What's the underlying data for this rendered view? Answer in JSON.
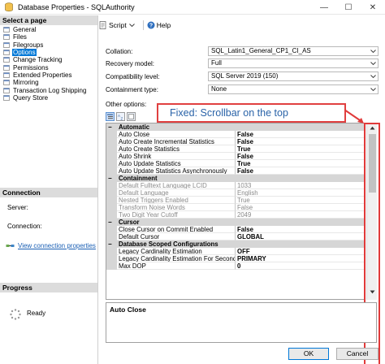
{
  "window": {
    "title": "Database Properties - SQLAuthority",
    "controls": [
      "minimize",
      "maximize",
      "close"
    ]
  },
  "left_pane": {
    "header": "Select a page",
    "pages": [
      {
        "label": "General",
        "selected": false
      },
      {
        "label": "Files",
        "selected": false
      },
      {
        "label": "Filegroups",
        "selected": false
      },
      {
        "label": "Options",
        "selected": true
      },
      {
        "label": "Change Tracking",
        "selected": false
      },
      {
        "label": "Permissions",
        "selected": false
      },
      {
        "label": "Extended Properties",
        "selected": false
      },
      {
        "label": "Mirroring",
        "selected": false
      },
      {
        "label": "Transaction Log Shipping",
        "selected": false
      },
      {
        "label": "Query Store",
        "selected": false
      }
    ],
    "connection": {
      "header": "Connection",
      "server_label": "Server:",
      "connection_label": "Connection:",
      "link": "View connection properties"
    },
    "progress": {
      "header": "Progress",
      "status": "Ready"
    }
  },
  "toolbar": {
    "script_label": "Script",
    "help_label": "Help"
  },
  "fields": {
    "collation": {
      "label": "Collation:",
      "value": "SQL_Latin1_General_CP1_CI_AS"
    },
    "recovery_model": {
      "label": "Recovery model:",
      "value": "Full"
    },
    "compatibility_level": {
      "label": "Compatibility level:",
      "value": "SQL Server 2019 (150)"
    },
    "containment_type": {
      "label": "Containment type:",
      "value": "None"
    }
  },
  "other_options_label": "Other options:",
  "callout": "Fixed: Scrollbar on the top",
  "property_grid": {
    "rows": [
      {
        "type": "category",
        "name": "Automatic"
      },
      {
        "type": "prop",
        "name": "Auto Close",
        "value": "False"
      },
      {
        "type": "prop",
        "name": "Auto Create Incremental Statistics",
        "value": "False"
      },
      {
        "type": "prop",
        "name": "Auto Create Statistics",
        "value": "True"
      },
      {
        "type": "prop",
        "name": "Auto Shrink",
        "value": "False"
      },
      {
        "type": "prop",
        "name": "Auto Update Statistics",
        "value": "True"
      },
      {
        "type": "prop",
        "name": "Auto Update Statistics Asynchronously",
        "value": "False"
      },
      {
        "type": "category",
        "name": "Containment"
      },
      {
        "type": "prop",
        "name": "Default Fulltext Language LCID",
        "value": "1033",
        "disabled": true
      },
      {
        "type": "prop",
        "name": "Default Language",
        "value": "English",
        "disabled": true
      },
      {
        "type": "prop",
        "name": "Nested Triggers Enabled",
        "value": "True",
        "disabled": true
      },
      {
        "type": "prop",
        "name": "Transform Noise Words",
        "value": "False",
        "disabled": true
      },
      {
        "type": "prop",
        "name": "Two Digit Year Cutoff",
        "value": "2049",
        "disabled": true
      },
      {
        "type": "category",
        "name": "Cursor"
      },
      {
        "type": "prop",
        "name": "Close Cursor on Commit Enabled",
        "value": "False"
      },
      {
        "type": "prop",
        "name": "Default Cursor",
        "value": "GLOBAL"
      },
      {
        "type": "category",
        "name": "Database Scoped Configurations"
      },
      {
        "type": "prop",
        "name": "Legacy Cardinality Estimation",
        "value": "OFF"
      },
      {
        "type": "prop",
        "name": "Legacy Cardinality Estimation For Secondary",
        "value": "PRIMARY"
      },
      {
        "type": "prop",
        "name": "Max DOP",
        "value": "0"
      }
    ]
  },
  "description": {
    "title": "Auto Close"
  },
  "buttons": {
    "ok": "OK",
    "cancel": "Cancel"
  },
  "colors": {
    "selection": "#0078d7",
    "highlight_border": "#e03a3a",
    "callout_text": "#2a63a8",
    "link": "#1a5fb4"
  }
}
